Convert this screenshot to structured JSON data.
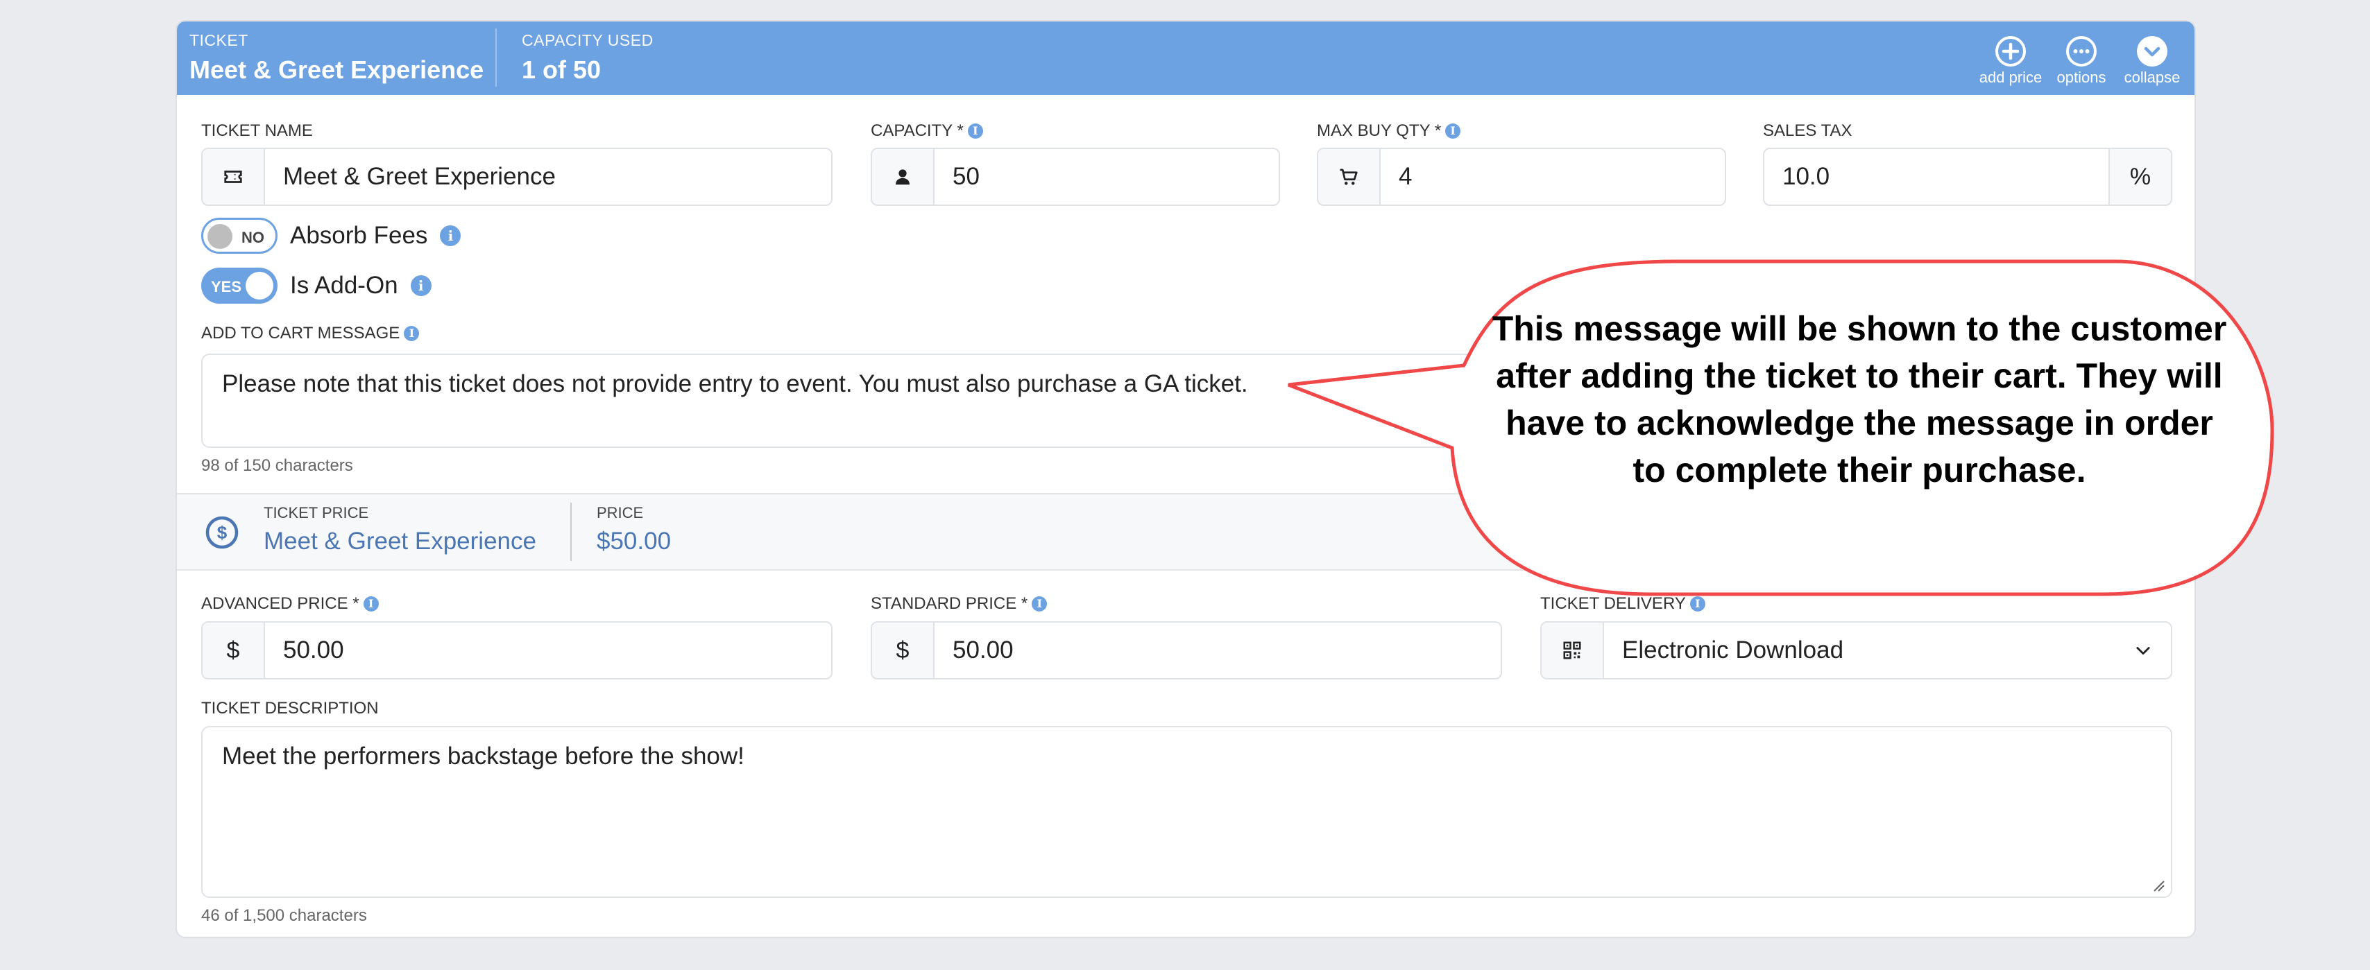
{
  "header": {
    "ticket_label": "TICKET",
    "ticket_name": "Meet & Greet Experience",
    "capacity_label": "CAPACITY USED",
    "capacity_value": "1 of 50",
    "actions": [
      {
        "icon": "plus-circle-icon",
        "label": "add price"
      },
      {
        "icon": "ellipsis-circle-icon",
        "label": "options"
      },
      {
        "icon": "chevron-down-circle-icon",
        "label": "collapse"
      }
    ]
  },
  "fields": {
    "ticket_name": {
      "label": "TICKET NAME",
      "icon": "ticket-icon",
      "value": "Meet & Greet Experience"
    },
    "capacity": {
      "label": "CAPACITY *",
      "icon": "person-icon",
      "value": "50"
    },
    "max_buy_qty": {
      "label": "MAX BUY QTY *",
      "icon": "cart-icon",
      "value": "4"
    },
    "sales_tax": {
      "label": "SALES TAX",
      "value": "10.0",
      "suffix": "%"
    }
  },
  "toggles": [
    {
      "label": "Absorb Fees",
      "state": "NO",
      "on": false
    },
    {
      "label": "Is Add-On",
      "state": "YES",
      "on": true
    }
  ],
  "add_to_cart": {
    "label": "ADD TO CART MESSAGE",
    "value": "Please note that this ticket does not provide entry to event.  You must also purchase a GA ticket.",
    "counter": "98 of 150 characters"
  },
  "ticket_price": {
    "label": "TICKET PRICE",
    "name": "Meet & Greet Experience",
    "price_label": "PRICE",
    "price_value": "$50.00"
  },
  "price_fields": {
    "advanced": {
      "label": "ADVANCED PRICE *",
      "prefix": "$",
      "value": "50.00"
    },
    "standard": {
      "label": "STANDARD PRICE *",
      "prefix": "$",
      "value": "50.00"
    },
    "delivery": {
      "label": "TICKET DELIVERY",
      "icon": "qr-code-icon",
      "value": "Electronic Download"
    }
  },
  "description": {
    "label": "TICKET DESCRIPTION",
    "value": "Meet the performers backstage before the show!",
    "counter": "46 of 1,500 characters"
  },
  "callout": {
    "text": "This message will be shown to the customer after adding the ticket to their cart.  They will have to acknowledge the message in order to complete their purchase.",
    "border_color": "#f04848"
  },
  "colors": {
    "accent": "#6ca2e2",
    "price_text": "#4a77b4"
  }
}
